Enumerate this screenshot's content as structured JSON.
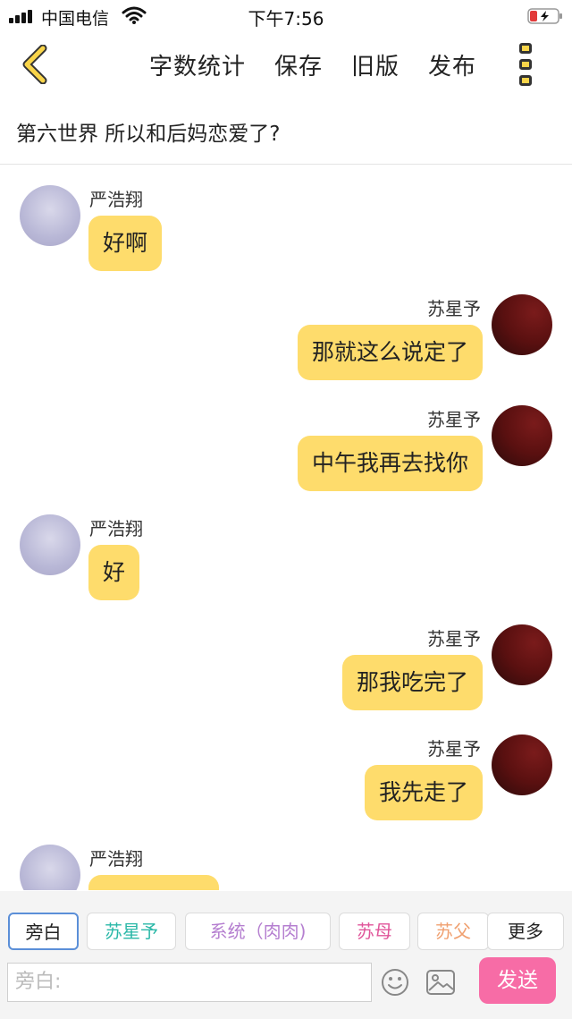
{
  "status_bar": {
    "carrier": "中国电信",
    "time": "下午7:56"
  },
  "nav": {
    "word_count": "字数统计",
    "save": "保存",
    "old_version": "旧版",
    "publish": "发布"
  },
  "chapter_title": "第六世界  所以和后妈恋爱了?",
  "messages": [
    {
      "side": "left",
      "name": "严浩翔",
      "text": "好啊"
    },
    {
      "side": "right",
      "name": "苏星予",
      "text": "那就这么说定了"
    },
    {
      "side": "right",
      "name": "苏星予",
      "text": "中午我再去找你"
    },
    {
      "side": "left",
      "name": "严浩翔",
      "text": "好"
    },
    {
      "side": "right",
      "name": "苏星予",
      "text": "那我吃完了"
    },
    {
      "side": "right",
      "name": "苏星予",
      "text": "我先走了"
    },
    {
      "side": "left",
      "name": "严浩翔",
      "text": ""
    }
  ],
  "roles": [
    {
      "label": "旁白",
      "color": "#222222"
    },
    {
      "label": "苏星予",
      "color": "#2bb8a8"
    },
    {
      "label": "系统（肉肉)",
      "color": "#b57fd0"
    },
    {
      "label": "苏母",
      "color": "#e0559a"
    },
    {
      "label": "苏父",
      "color": "#f0a070"
    },
    {
      "label": "更多",
      "color": "#222222"
    }
  ],
  "input": {
    "placeholder": "旁白:"
  },
  "send_label": "发送",
  "colors": {
    "bubble": "#fedc6c",
    "send": "#f76ca6",
    "accent": "#f9d54a"
  }
}
